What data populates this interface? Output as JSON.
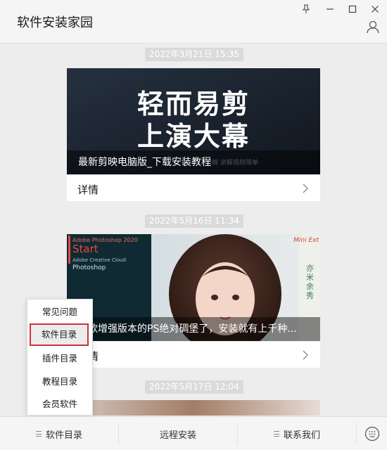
{
  "header": {
    "title": "软件安装家园"
  },
  "feed": {
    "items": [
      {
        "time": "2022年3月21日  15:35",
        "headline_l1": "轻而易剪",
        "headline_l2": "上演大幕",
        "bg_text": "剪映 讲解视频简单",
        "caption": "最新剪映电脑版_下载安装教程",
        "detail": "详情"
      },
      {
        "time": "2022年5月16日  11:34",
        "ps_brand": "Adobe Photoshop 2020",
        "ps_start": "Start",
        "ps_line1": "Adobe Creative Cloud",
        "ps_line2": "Photoshop",
        "mini_ext": "Mini Ext",
        "vertical_text": "亦米余秀",
        "caption": "这款增强版本的PS绝对碉堡了，安装就有上千种...",
        "detail": "详情"
      },
      {
        "time": "2022年5月17日  12:04"
      }
    ]
  },
  "popup": {
    "items": [
      "常见问题",
      "软件目录",
      "插件目录",
      "教程目录",
      "会员软件"
    ],
    "selected_index": 1,
    "highlight_color": "#d0323a"
  },
  "bottom": {
    "tabs": [
      "软件目录",
      "远程安装",
      "联系我们"
    ]
  },
  "colors": {
    "background": "#ededed",
    "time_badge": "#dadada",
    "card1_bg": "#1a2430"
  }
}
